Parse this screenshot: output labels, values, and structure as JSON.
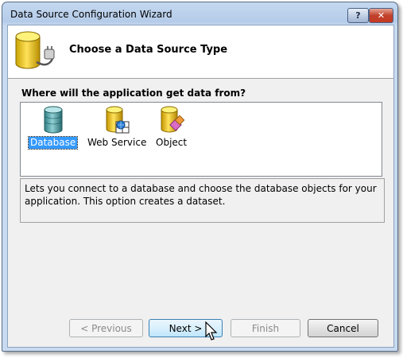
{
  "window": {
    "title": "Data Source Configuration Wizard",
    "help_label": "?",
    "close_label": "✕"
  },
  "header": {
    "title": "Choose a Data Source Type",
    "icon": "database-plug-icon"
  },
  "question": "Where will the application get data from?",
  "sources": [
    {
      "label": "Database",
      "icon": "database-icon",
      "selected": true
    },
    {
      "label": "Web Service",
      "icon": "web-service-icon",
      "selected": false
    },
    {
      "label": "Object",
      "icon": "object-icon",
      "selected": false
    }
  ],
  "description": "Lets you connect to a database and choose the database objects for your application. This option creates a dataset.",
  "buttons": {
    "previous": "< Previous",
    "next": "Next >",
    "finish": "Finish",
    "cancel": "Cancel"
  },
  "colors": {
    "selection": "#3399ff",
    "titlebar": "#b5cce9",
    "close": "#c53a22"
  }
}
